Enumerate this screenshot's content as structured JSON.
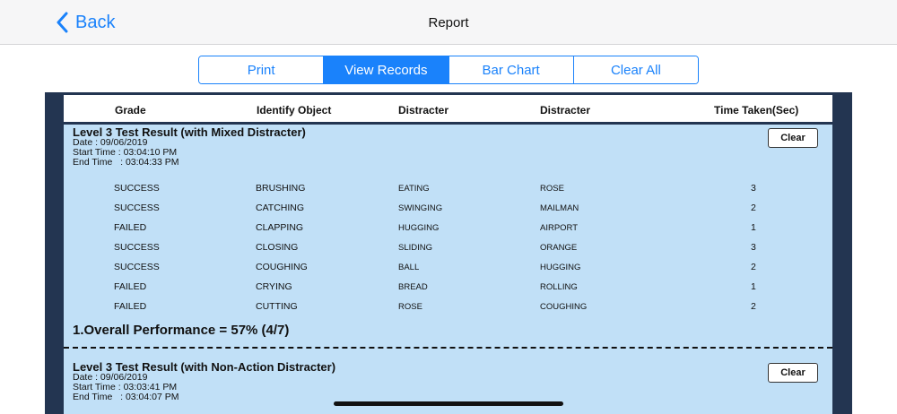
{
  "nav": {
    "back_label": "Back",
    "title": "Report"
  },
  "segments": [
    {
      "label": "Print",
      "active": false
    },
    {
      "label": "View Records",
      "active": true
    },
    {
      "label": "Bar Chart",
      "active": false
    },
    {
      "label": "Clear All",
      "active": false
    }
  ],
  "table": {
    "headers": [
      "Grade",
      "Identify Object",
      "Distracter",
      "Distracter",
      "Time Taken(Sec)"
    ]
  },
  "records": [
    {
      "title": "Level 3 Test Result (with Mixed Distracter)",
      "date": "Date : 09/06/2019",
      "start": "Start Time : 03:04:10 PM",
      "end": "End Time   : 03:04:33 PM",
      "clear_label": "Clear",
      "rows": [
        [
          "SUCCESS",
          "BRUSHING",
          "EATING",
          "ROSE",
          "3"
        ],
        [
          "SUCCESS",
          "CATCHING",
          "SWINGING",
          "MAILMAN",
          "2"
        ],
        [
          "FAILED",
          "CLAPPING",
          "HUGGING",
          "AIRPORT",
          "1"
        ],
        [
          "SUCCESS",
          "CLOSING",
          "SLIDING",
          "ORANGE",
          "3"
        ],
        [
          "SUCCESS",
          "COUGHING",
          "BALL",
          "HUGGING",
          "2"
        ],
        [
          "FAILED",
          "CRYING",
          "BREAD",
          "ROLLING",
          "1"
        ],
        [
          "FAILED",
          "CUTTING",
          "ROSE",
          "COUGHING",
          "2"
        ]
      ],
      "overall": "1.Overall Performance = 57% (4/7)"
    },
    {
      "title": "Level 3 Test Result (with Non-Action Distracter)",
      "date": "Date : 09/06/2019",
      "start": "Start Time : 03:03:41 PM",
      "end": "End Time   : 03:04:07 PM",
      "clear_label": "Clear"
    }
  ],
  "colors": {
    "accent": "#1a82fb",
    "frame": "#233551",
    "content_bg": "#c1e0f7"
  }
}
